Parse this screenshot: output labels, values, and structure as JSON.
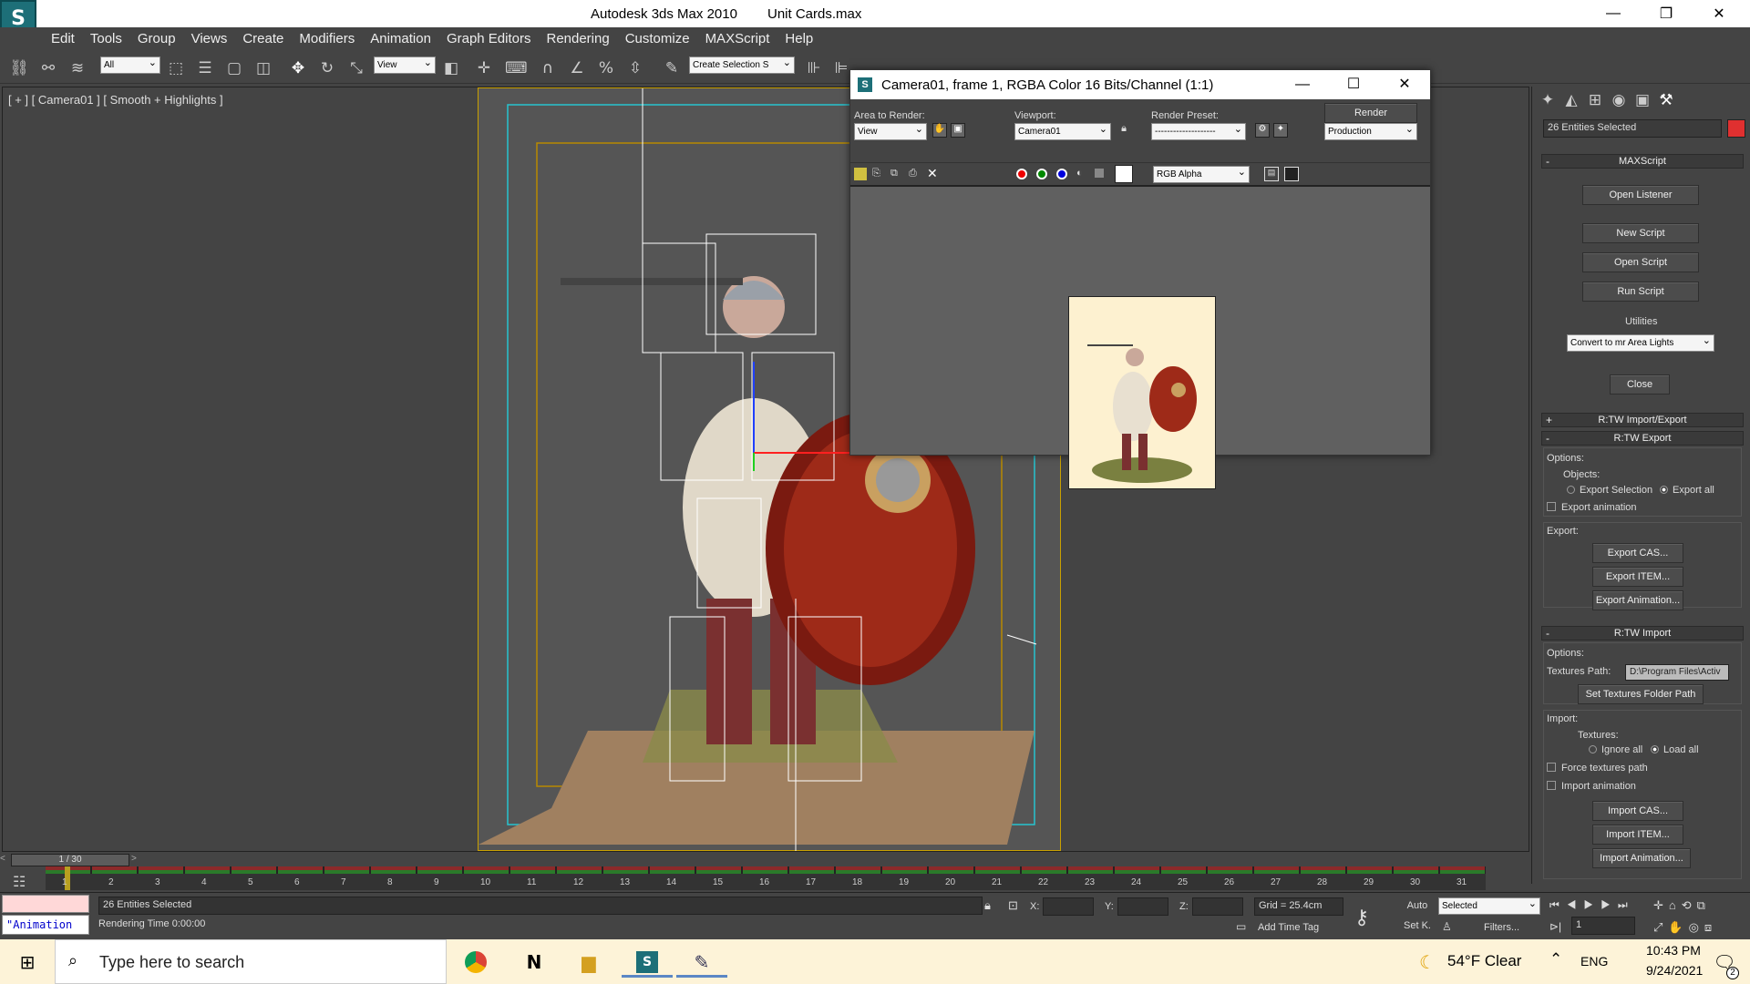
{
  "app": {
    "title": "Autodesk 3ds Max  2010",
    "file": "Unit Cards.max",
    "logo_icon": "3dsmax-logo-icon"
  },
  "menu": [
    "Edit",
    "Tools",
    "Group",
    "Views",
    "Create",
    "Modifiers",
    "Animation",
    "Graph Editors",
    "Rendering",
    "Customize",
    "MAXScript",
    "Help"
  ],
  "toolbar": {
    "selection_filter": "All",
    "ref_coord": "View",
    "named_selection": "Create Selection S"
  },
  "viewport": {
    "label": "[ + ] [ Camera01 ] [ Smooth + Highlights ]"
  },
  "render_window": {
    "title": "Camera01, frame 1, RGBA Color 16 Bits/Channel (1:1)",
    "area_label": "Area to Render:",
    "area_value": "View",
    "viewport_label": "Viewport:",
    "viewport_value": "Camera01",
    "preset_label": "Render Preset:",
    "preset_value": "--------------------",
    "render_button": "Render",
    "mode_value": "Production",
    "channel_value": "RGB Alpha"
  },
  "command_panel": {
    "selection_text": "26 Entities Selected",
    "maxscript": {
      "title": "MAXScript",
      "open_listener": "Open Listener",
      "new_script": "New Script",
      "open_script": "Open Script",
      "run_script": "Run Script",
      "utilities_label": "Utilities",
      "utilities_value": "Convert to mr Area Lights",
      "close": "Close"
    },
    "rtw_import_export": "R:TW Import/Export",
    "rtw_export": {
      "title": "R:TW Export",
      "options": "Options:",
      "objects": "Objects:",
      "export_selection": "Export Selection",
      "export_all": "Export all",
      "export_animation": "Export animation",
      "export_label": "Export:",
      "export_cas": "Export CAS...",
      "export_item": "Export ITEM...",
      "export_anim_btn": "Export Animation..."
    },
    "rtw_import": {
      "title": "R:TW Import",
      "options": "Options:",
      "textures_path_label": "Textures Path:",
      "textures_path_value": "D:\\Program Files\\Activ",
      "set_textures": "Set Textures Folder Path",
      "import_label": "Import:",
      "textures": "Textures:",
      "ignore_all": "Ignore all",
      "load_all": "Load all",
      "force_textures": "Force textures path",
      "import_animation": "Import animation",
      "import_cas": "Import CAS...",
      "import_item": "Import ITEM...",
      "import_anim_btn": "Import Animation..."
    }
  },
  "timeline": {
    "frame": "1 / 30",
    "ticks": [
      "1",
      "2",
      "3",
      "4",
      "5",
      "6",
      "7",
      "8",
      "9",
      "10",
      "11",
      "12",
      "13",
      "14",
      "15",
      "16",
      "17",
      "18",
      "19",
      "20",
      "21",
      "22",
      "23",
      "24",
      "25",
      "26",
      "27",
      "28",
      "29",
      "30",
      "31"
    ]
  },
  "status": {
    "maxscript_mini": "\"Animation",
    "entities": "26 Entities Selected",
    "render_time": "Rendering Time  0:00:00",
    "x_label": "X:",
    "y_label": "Y:",
    "z_label": "Z:",
    "grid": "Grid = 25.4cm",
    "add_time_tag": "Add Time Tag",
    "auto": "Auto",
    "set_key": "Set K.",
    "key_filter": "Selected",
    "filters": "Filters...",
    "frame_input": "1"
  },
  "taskbar": {
    "search_placeholder": "Type here to search",
    "weather": "54°F  Clear",
    "lang": "ENG",
    "time": "10:43 PM",
    "date": "9/24/2021",
    "notif_count": "2"
  }
}
